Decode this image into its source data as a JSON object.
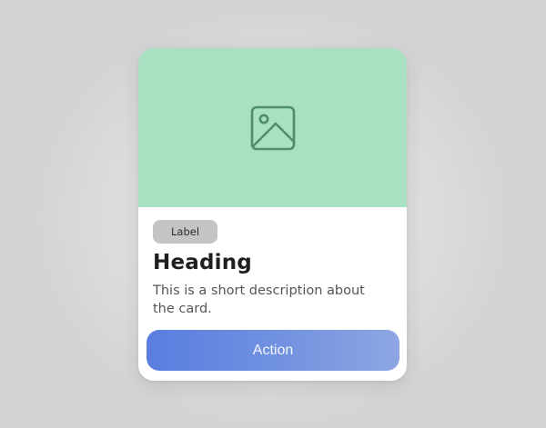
{
  "card": {
    "media_icon": "image-placeholder-icon",
    "label": "Label",
    "heading": "Heading",
    "description": "This is a short description about the card.",
    "action_label": "Action"
  },
  "colors": {
    "media_background": "#a8e0c1",
    "media_icon": "#4e8f68",
    "label_background": "#c4c4c6",
    "action_gradient_start": "#5a7de0",
    "action_gradient_end": "#8ea6e2"
  }
}
